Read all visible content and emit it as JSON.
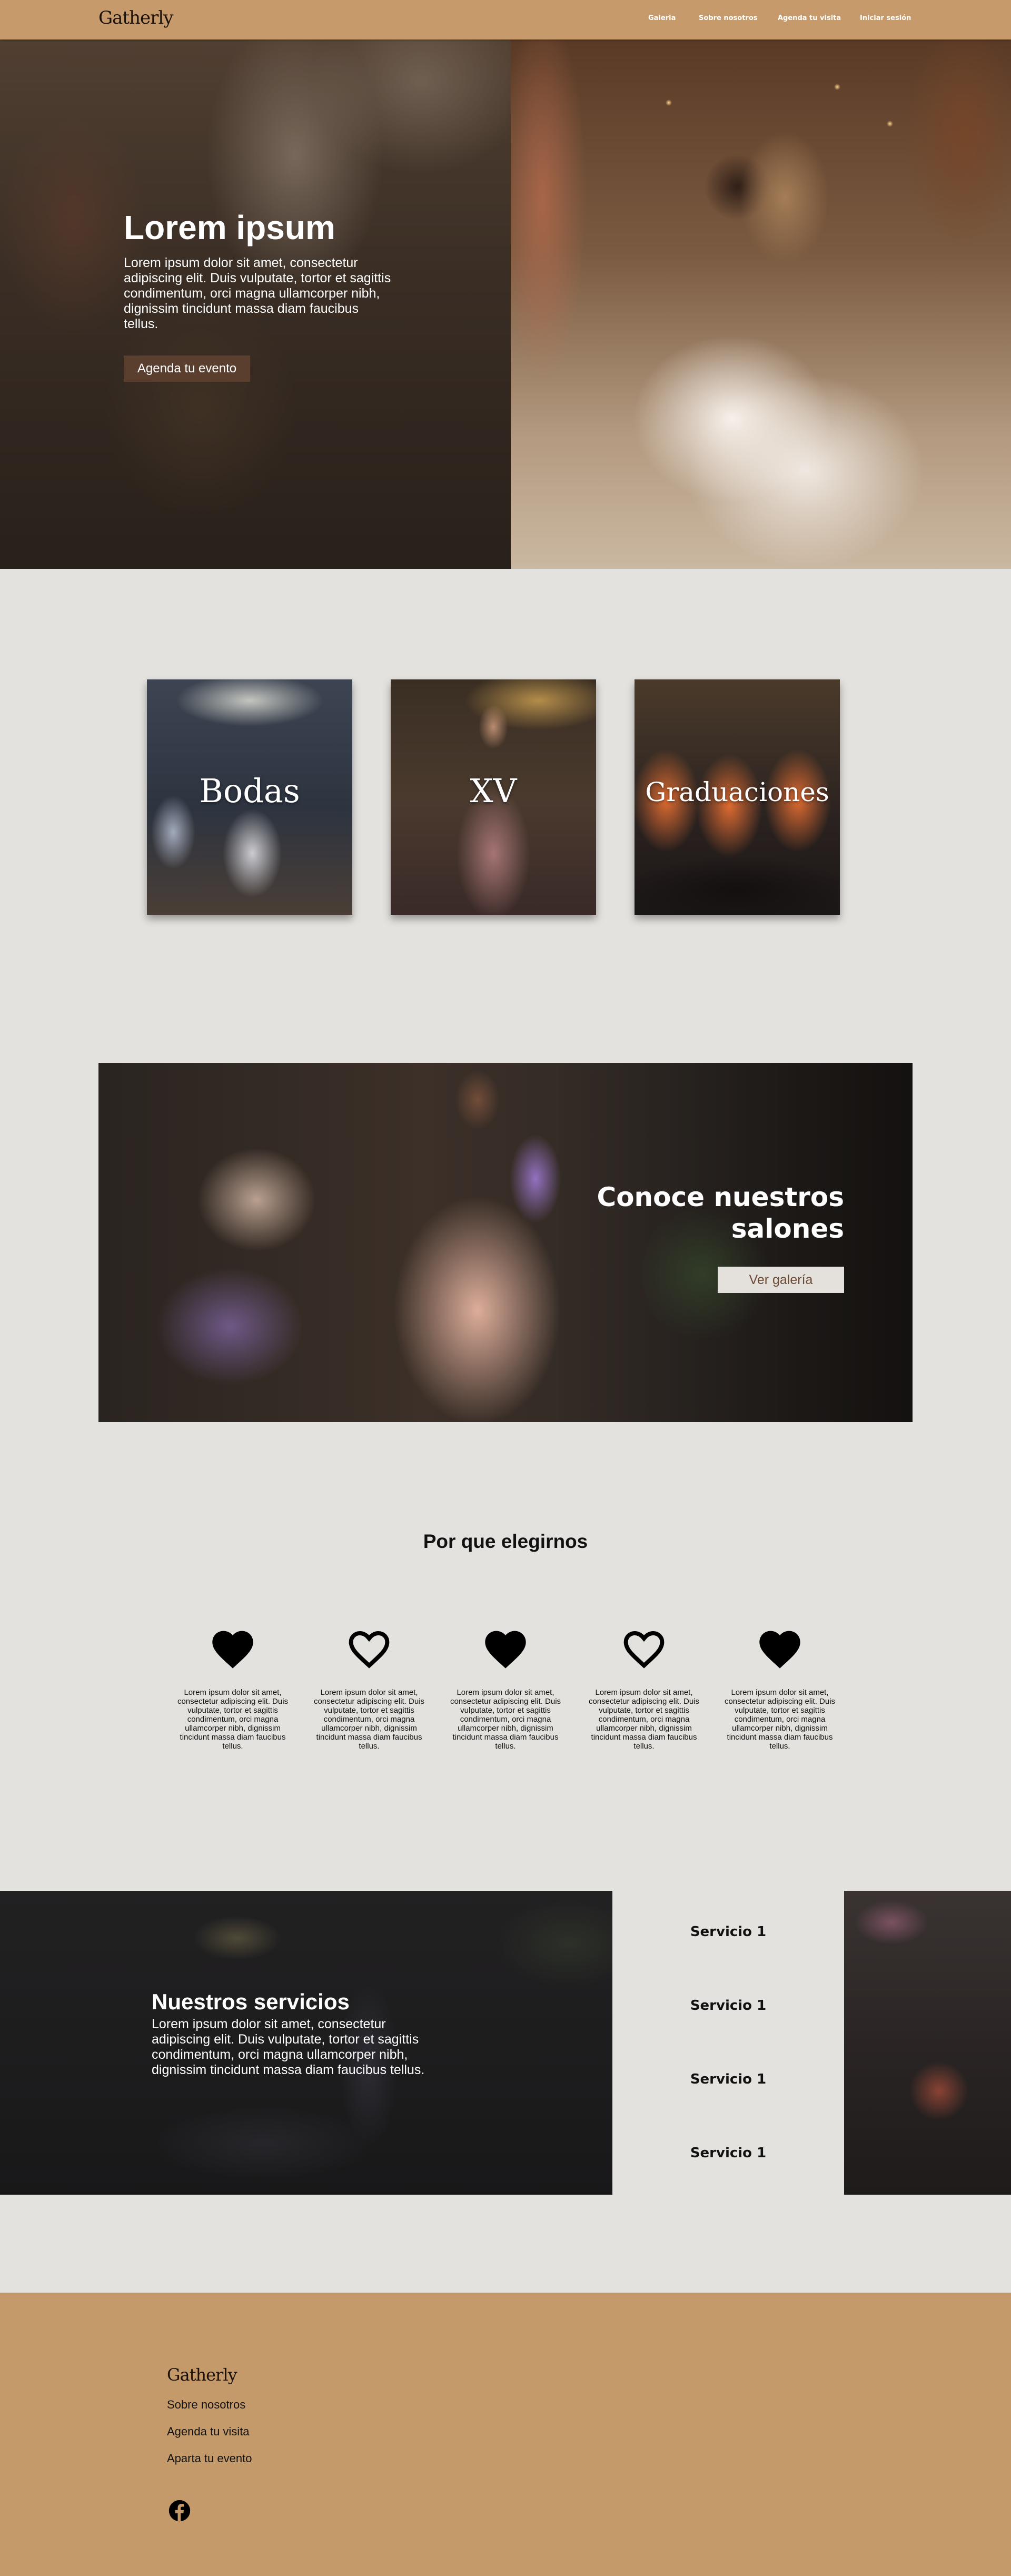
{
  "nav": {
    "logo": "Gatherly",
    "links": [
      "Galeria",
      "Sobre nosotros",
      "Agenda tu visita",
      "Iniciar sesión"
    ]
  },
  "hero": {
    "title": "Lorem ipsum",
    "text": "Lorem ipsum dolor sit amet, consectetur adipiscing elit. Duis vulputate, tortor et sagittis condimentum, orci magna ullamcorper nibh, dignissim tincidunt massa diam faucibus tellus.",
    "cta": "Agenda tu evento"
  },
  "categories": [
    "Bodas",
    "XV",
    "Graduaciones"
  ],
  "salones": {
    "title": "Conoce nuestros salones",
    "cta": "Ver galería"
  },
  "why": {
    "title": "Por que elegirnos",
    "features": [
      {
        "icon": "heart-filled-icon",
        "text": "Lorem ipsum dolor sit amet, consectetur adipiscing elit. Duis vulputate, tortor et sagittis condimentum, orci magna ullamcorper nibh, dignissim tincidunt massa diam faucibus tellus."
      },
      {
        "icon": "heart-outline-icon",
        "text": "Lorem ipsum dolor sit amet, consectetur adipiscing elit. Duis vulputate, tortor et sagittis condimentum, orci magna ullamcorper nibh, dignissim tincidunt massa diam faucibus tellus."
      },
      {
        "icon": "heart-filled-icon",
        "text": "Lorem ipsum dolor sit amet, consectetur adipiscing elit. Duis vulputate, tortor et sagittis condimentum, orci magna ullamcorper nibh, dignissim tincidunt massa diam faucibus tellus."
      },
      {
        "icon": "heart-outline-icon",
        "text": "Lorem ipsum dolor sit amet, consectetur adipiscing elit. Duis vulputate, tortor et sagittis condimentum, orci magna ullamcorper nibh, dignissim tincidunt massa diam faucibus tellus."
      },
      {
        "icon": "heart-filled-icon",
        "text": "Lorem ipsum dolor sit amet, consectetur adipiscing elit. Duis vulputate, tortor et sagittis condimentum, orci magna ullamcorper nibh, dignissim tincidunt massa diam faucibus tellus."
      }
    ]
  },
  "services": {
    "title": "Nuestros servicios",
    "text": "Lorem ipsum dolor sit amet, consectetur adipiscing elit. Duis vulputate, tortor et sagittis condimentum, orci magna ullamcorper nibh, dignissim tincidunt massa diam faucibus tellus.",
    "items": [
      "Servicio 1",
      "Servicio 1",
      "Servicio 1",
      "Servicio 1"
    ]
  },
  "footer": {
    "logo": "Gatherly",
    "links": [
      "Sobre nosotros",
      "Agenda tu visita",
      "Aparta tu evento"
    ],
    "social_icon": "facebook-icon"
  },
  "colors": {
    "nav_bg": "#c69a6a",
    "page_bg": "#e4e2de",
    "footer_bg": "#c59a6a",
    "hero_button": "#5b3f2e"
  }
}
